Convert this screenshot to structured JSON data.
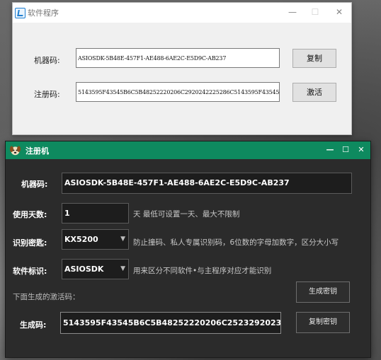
{
  "top_window": {
    "title": "软件程序",
    "controls": {
      "minimize": "—",
      "maximize": "☐",
      "close": "✕"
    },
    "machine_code_label": "机器码:",
    "machine_code_value": "ASIOSDK-5B48E-457F1-AE488-6AE2C-E5D9C-AB237",
    "copy_button": "复制",
    "reg_code_label": "注册码:",
    "reg_code_value": "5143595F43545B6C5B48252220206C2920242225286C5143595F43545B3D2720",
    "activate_button": "激活"
  },
  "keygen_window": {
    "title": "注册机",
    "controls": {
      "minimize": "—",
      "maximize": "☐",
      "close": "✕"
    },
    "machine_code_label": "机器码:",
    "machine_code_value": "ASIOSDK-5B48E-457F1-AE488-6AE2C-E5D9C-AB237",
    "days_label": "使用天数:",
    "days_value": "1",
    "days_hint": "天   最低可设置一天、最大不限制",
    "secret_label": "识别密匙:",
    "secret_value": "KX5200",
    "secret_hint": "防止撞码、私人专属识别码，6位数的字母加数字，区分大小写",
    "soft_label": "软件标识:",
    "soft_value": "ASIOSDK",
    "soft_hint": "用来区分不同软件•与主程序对应才能识别",
    "generated_note": "下面生成的激活码：",
    "generate_button": "生成密钥",
    "result_label": "生成码:",
    "result_value": "5143595F43545B6C5B48252220206C2523292023266C51",
    "copy_key_button": "复制密钥"
  },
  "colors": {
    "accent": "#0e8a5f",
    "dark_bg": "#2b2b2b"
  },
  "icons": {
    "top_app": "app-icon",
    "keygen_app": "dog-icon"
  }
}
